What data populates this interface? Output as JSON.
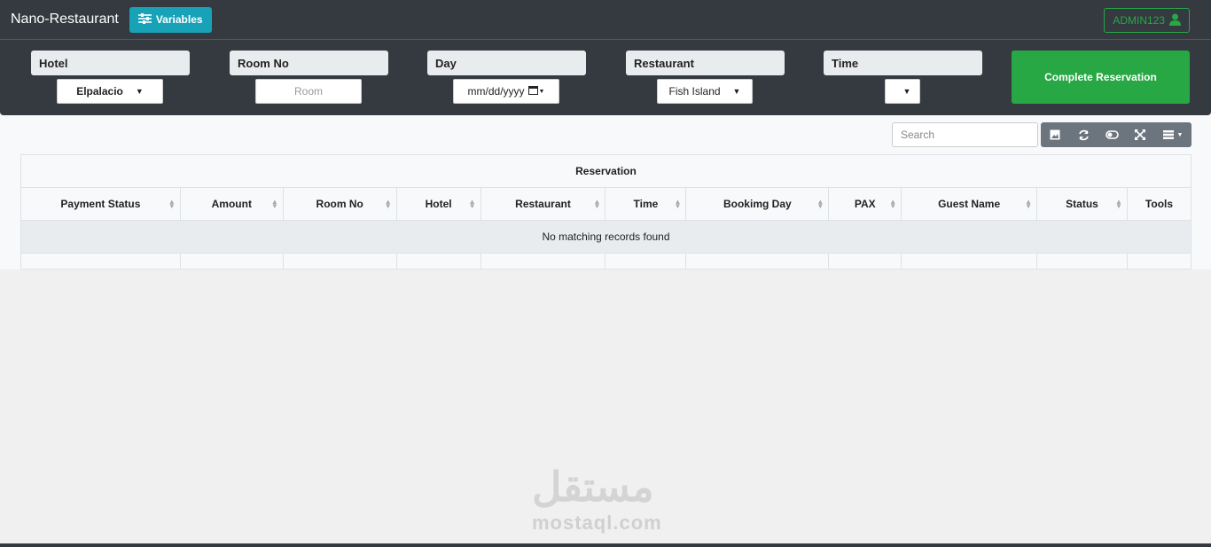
{
  "navbar": {
    "brand": "Nano-Restaurant",
    "variables_label": "Variables",
    "admin_label": "ADMIN123"
  },
  "form": {
    "hotel_label": "Hotel",
    "hotel_value": "Elpalacio",
    "room_label": "Room No",
    "room_placeholder": "Room",
    "day_label": "Day",
    "day_placeholder": "mm/dd/yyyy",
    "restaurant_label": "Restaurant",
    "restaurant_value": "Fish Island",
    "time_label": "Time",
    "time_value": "",
    "complete_label": "Complete Reservation"
  },
  "table": {
    "search_placeholder": "Search",
    "caption": "Reservation",
    "columns": [
      "Payment Status",
      "Amount",
      "Room No",
      "Hotel",
      "Restaurant",
      "Time",
      "Bookimg Day",
      "PAX",
      "Guest Name",
      "Status",
      "Tools"
    ],
    "empty_message": "No matching records found"
  },
  "watermark": {
    "arabic": "مستقل",
    "latin": "mostaql.com"
  },
  "colors": {
    "navbar": "#343a40",
    "info": "#17a2b8",
    "success": "#28a745",
    "secondary": "#6c757d"
  }
}
